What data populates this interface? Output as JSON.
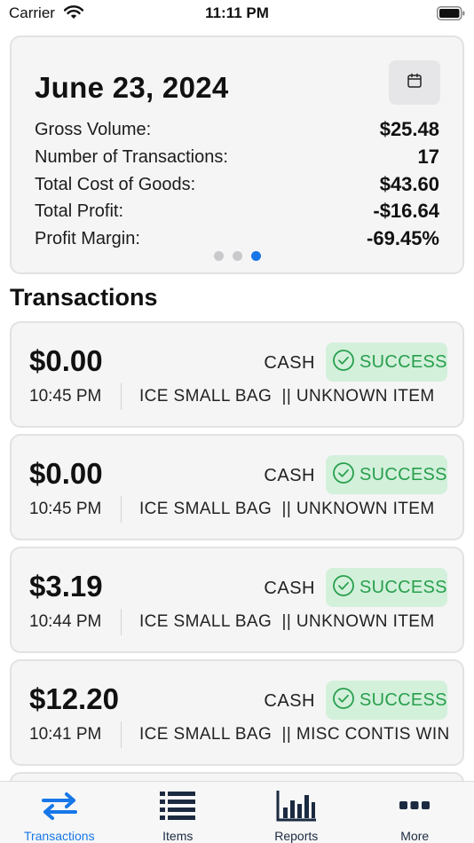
{
  "status_bar": {
    "carrier": "Carrier",
    "time": "11:11 PM"
  },
  "summary": {
    "date": "June 23, 2024",
    "stats": [
      {
        "label": "Gross Volume:",
        "value": "$25.48"
      },
      {
        "label": "Number of Transactions:",
        "value": "17"
      },
      {
        "label": "Total Cost of Goods:",
        "value": "$43.60"
      },
      {
        "label": "Total Profit:",
        "value": "-$16.64"
      },
      {
        "label": "Profit Margin:",
        "value": "-69.45%"
      }
    ],
    "page_indicator": {
      "count": 3,
      "active_index": 2
    }
  },
  "transactions_title": "Transactions",
  "transactions": [
    {
      "amount": "$0.00",
      "method": "CASH",
      "status": "SUCCESS",
      "time": "10:45 PM",
      "items": "ICE SMALL BAG  || UNKNOWN ITEM"
    },
    {
      "amount": "$0.00",
      "method": "CASH",
      "status": "SUCCESS",
      "time": "10:45 PM",
      "items": "ICE SMALL BAG  || UNKNOWN ITEM"
    },
    {
      "amount": "$3.19",
      "method": "CASH",
      "status": "SUCCESS",
      "time": "10:44 PM",
      "items": "ICE SMALL BAG  || UNKNOWN ITEM"
    },
    {
      "amount": "$12.20",
      "method": "CASH",
      "status": "SUCCESS",
      "time": "10:41 PM",
      "items": "ICE SMALL BAG  || MISC CONTIS WINE"
    }
  ],
  "tabs": [
    {
      "label": "Transactions",
      "icon": "arrows-swap-icon",
      "active": true
    },
    {
      "label": "Items",
      "icon": "list-icon",
      "active": false
    },
    {
      "label": "Reports",
      "icon": "bar-chart-icon",
      "active": false
    },
    {
      "label": "More",
      "icon": "more-dots-icon",
      "active": false
    }
  ],
  "colors": {
    "accent": "#1877e8",
    "success_bg": "#d3f0db",
    "success_text": "#279f4c",
    "card_bg": "#f5f5f6"
  }
}
